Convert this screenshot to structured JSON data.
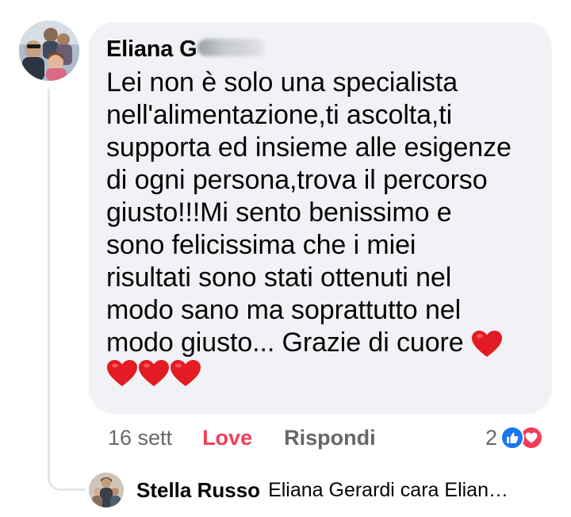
{
  "comment": {
    "author_visible": "Eliana G",
    "text": "Lei non è solo una specialista\nnell'alimentazione,ti ascolta,ti\nsupporta ed insieme alle esigenze\ndi ogni persona,trova il percorso\ngiusto!!!Mi sento benissimo e\nsono felicissima che i miei\nrisultati sono stati ottenuti nel\nmodo sano ma soprattutto nel\nmodo giusto... Grazie di cuore ",
    "emoji_trailing": "❤️",
    "emoji_row": [
      "❤️",
      "❤️",
      "❤️"
    ],
    "avatar_icon": "family-photo-avatar"
  },
  "actions": {
    "timestamp": "16 sett",
    "reaction_label": "Love",
    "reply_label": "Rispondi"
  },
  "reactions": {
    "count": "2",
    "types": [
      "like-icon",
      "love-icon"
    ],
    "like_color": "#1877f2",
    "love_color": "#f33e58"
  },
  "reply_preview": {
    "name": "Stella Russo",
    "text": "Eliana Gerardi  cara Elian…",
    "avatar_icon": "group-photo-avatar"
  },
  "colors": {
    "bubble": "#f0f2f5",
    "meta_text": "#65676b",
    "love_accent": "#f33e58"
  }
}
